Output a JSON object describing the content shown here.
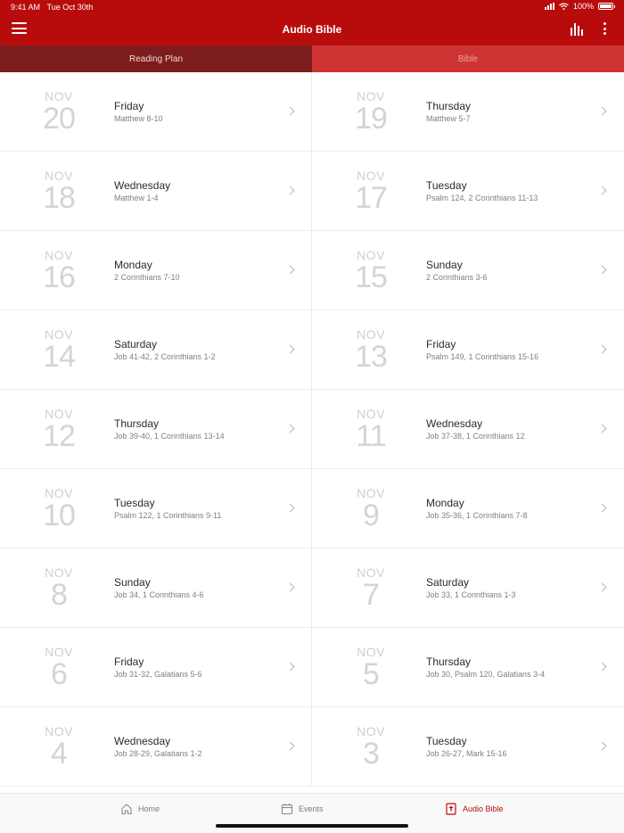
{
  "status_bar": {
    "time": "9:41 AM",
    "date": "Tue Oct 30th",
    "battery_text": "100%",
    "battery_level": 1.0,
    "signal_icon": "cellular-signal-icon",
    "wifi_icon": "wifi-icon"
  },
  "navbar": {
    "title": "Audio Bible",
    "menu_icon": "hamburger-menu-icon",
    "equalizer_icon": "audio-levels-icon",
    "more_icon": "vertical-ellipsis-icon",
    "background": "#b80c0c"
  },
  "tabs": [
    {
      "label": "Reading Plan",
      "active": true
    },
    {
      "label": "Bible",
      "active": false
    }
  ],
  "rows": [
    {
      "left": {
        "month": "NOV",
        "day": "20",
        "weekday": "Friday",
        "passage": "Matthew 8-10"
      },
      "right": {
        "month": "NOV",
        "day": "19",
        "weekday": "Thursday",
        "passage": "Matthew 5-7"
      }
    },
    {
      "left": {
        "month": "NOV",
        "day": "18",
        "weekday": "Wednesday",
        "passage": "Matthew 1-4"
      },
      "right": {
        "month": "NOV",
        "day": "17",
        "weekday": "Tuesday",
        "passage": "Psalm 124, 2 Corinthians 11-13"
      }
    },
    {
      "left": {
        "month": "NOV",
        "day": "16",
        "weekday": "Monday",
        "passage": "2 Corinthians 7-10"
      },
      "right": {
        "month": "NOV",
        "day": "15",
        "weekday": "Sunday",
        "passage": "2 Corinthians 3-6"
      }
    },
    {
      "left": {
        "month": "NOV",
        "day": "14",
        "weekday": "Saturday",
        "passage": "Job 41-42, 2 Corinthians 1-2"
      },
      "right": {
        "month": "NOV",
        "day": "13",
        "weekday": "Friday",
        "passage": "Psalm 149, 1 Corinthians 15-16"
      }
    },
    {
      "left": {
        "month": "NOV",
        "day": "12",
        "weekday": "Thursday",
        "passage": "Job 39-40, 1 Corinthians 13-14"
      },
      "right": {
        "month": "NOV",
        "day": "11",
        "weekday": "Wednesday",
        "passage": "Job 37-38, 1 Corinthians 12"
      }
    },
    {
      "left": {
        "month": "NOV",
        "day": "10",
        "weekday": "Tuesday",
        "passage": "Psalm 122, 1 Corinthians 9-11"
      },
      "right": {
        "month": "NOV",
        "day": "9",
        "weekday": "Monday",
        "passage": "Job 35-36, 1 Corinthians 7-8"
      }
    },
    {
      "left": {
        "month": "NOV",
        "day": "8",
        "weekday": "Sunday",
        "passage": "Job 34, 1 Corinthians 4-6"
      },
      "right": {
        "month": "NOV",
        "day": "7",
        "weekday": "Saturday",
        "passage": "Job 33, 1 Corinthians 1-3"
      }
    },
    {
      "left": {
        "month": "NOV",
        "day": "6",
        "weekday": "Friday",
        "passage": "Job 31-32, Galatians 5-6"
      },
      "right": {
        "month": "NOV",
        "day": "5",
        "weekday": "Thursday",
        "passage": "Job 30, Psalm 120, Galatians 3-4"
      }
    },
    {
      "left": {
        "month": "NOV",
        "day": "4",
        "weekday": "Wednesday",
        "passage": "Job 28-29, Galatians 1-2"
      },
      "right": {
        "month": "NOV",
        "day": "3",
        "weekday": "Tuesday",
        "passage": "Job 26-27, Mark 15-16"
      }
    }
  ],
  "bottom_nav": [
    {
      "label": "Home",
      "icon": "home-icon",
      "active": false
    },
    {
      "label": "Events",
      "icon": "calendar-icon",
      "active": false
    },
    {
      "label": "Audio Bible",
      "icon": "bible-book-icon",
      "active": true
    }
  ],
  "colors": {
    "accent": "#b80c0c",
    "tab_active": "#7d1c1c",
    "tab_inactive": "#cf3434"
  }
}
